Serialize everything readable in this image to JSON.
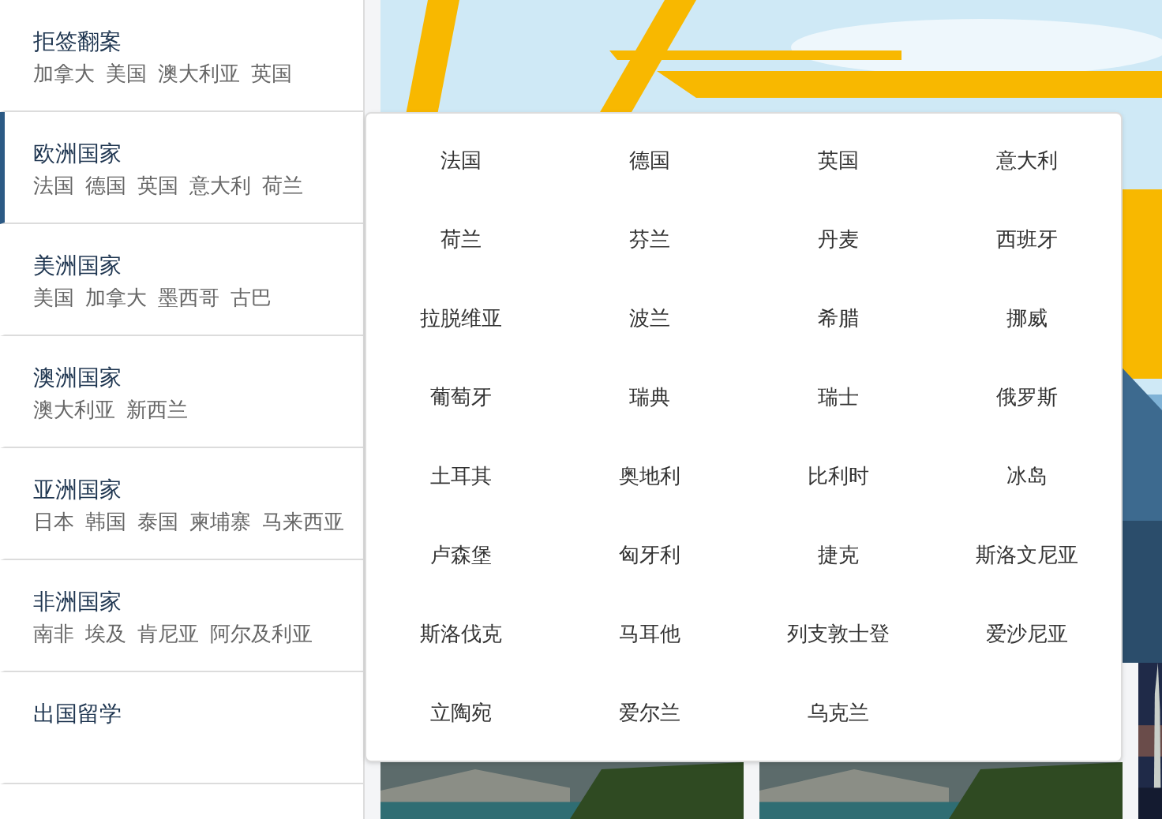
{
  "sidebar": {
    "items": [
      {
        "title": "拒签翻案",
        "countries": [
          "加拿大",
          "美国",
          "澳大利亚",
          "英国"
        ],
        "selected": false
      },
      {
        "title": "欧洲国家",
        "countries": [
          "法国",
          "德国",
          "英国",
          "意大利",
          "荷兰"
        ],
        "selected": true
      },
      {
        "title": "美洲国家",
        "countries": [
          "美国",
          "加拿大",
          "墨西哥",
          "古巴"
        ],
        "selected": false
      },
      {
        "title": "澳洲国家",
        "countries": [
          "澳大利亚",
          "新西兰"
        ],
        "selected": false
      },
      {
        "title": "亚洲国家",
        "countries": [
          "日本",
          "韩国",
          "泰国",
          "柬埔寨",
          "马来西亚"
        ],
        "selected": false
      },
      {
        "title": "非洲国家",
        "countries": [
          "南非",
          "埃及",
          "肯尼亚",
          "阿尔及利亚"
        ],
        "selected": false
      },
      {
        "title": "出国留学",
        "selected": false
      }
    ]
  },
  "dropdown": {
    "countries": [
      "法国",
      "德国",
      "英国",
      "意大利",
      "荷兰",
      "芬兰",
      "丹麦",
      "西班牙",
      "拉脱维亚",
      "波兰",
      "希腊",
      "挪威",
      "葡萄牙",
      "瑞典",
      "瑞士",
      "俄罗斯",
      "土耳其",
      "奥地利",
      "比利时",
      "冰岛",
      "卢森堡",
      "匈牙利",
      "捷克",
      "斯洛文尼亚",
      "斯洛伐克",
      "马耳他",
      "列支敦士登",
      "爱沙尼亚",
      "立陶宛",
      "爱尔兰",
      "乌克兰"
    ]
  }
}
